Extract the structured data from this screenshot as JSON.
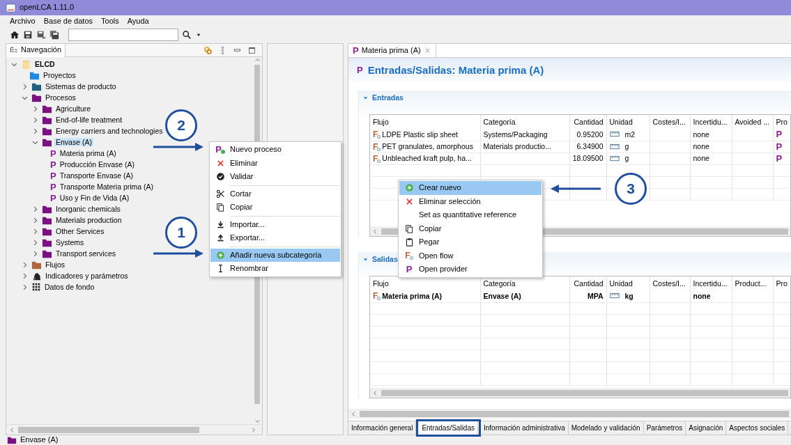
{
  "window": {
    "title": "openLCA 1.11.0"
  },
  "menu": [
    "Archivo",
    "Base de datos",
    "Tools",
    "Ayuda"
  ],
  "navigator": {
    "title": "Navegación",
    "tree": [
      {
        "label": "ELCD",
        "kind": "database",
        "expanded": true,
        "selected": false,
        "children": [
          {
            "label": "Proyectos",
            "kind": "folder",
            "color": "#1e88e5",
            "selected": false
          },
          {
            "label": "Sistemas de producto",
            "kind": "folder",
            "color": "#1f5f80",
            "expanded": false,
            "selected": false
          },
          {
            "label": "Procesos",
            "kind": "folder",
            "color": "#7b1080",
            "expanded": true,
            "selected": false,
            "children": [
              {
                "label": "Agriculture",
                "kind": "folder",
                "color": "#7b1080",
                "expanded": false,
                "selected": false
              },
              {
                "label": "End-of-life treatment",
                "kind": "folder",
                "color": "#7b1080",
                "expanded": false,
                "selected": false
              },
              {
                "label": "Energy carriers and technologies",
                "kind": "folder",
                "color": "#7b1080",
                "expanded": false,
                "selected": false
              },
              {
                "label": "Envase (A)",
                "kind": "folder",
                "color": "#7b1080",
                "expanded": true,
                "selected": true,
                "children": [
                  {
                    "label": "Materia prima (A)",
                    "kind": "process",
                    "glyph": "P",
                    "selected": false
                  },
                  {
                    "label": "Producción Envase (A)",
                    "kind": "process",
                    "glyph": "P",
                    "selected": false
                  },
                  {
                    "label": "Transporte Envase (A)",
                    "kind": "process",
                    "glyph": "P",
                    "selected": false
                  },
                  {
                    "label": "Transporte Materia prima (A)",
                    "kind": "process",
                    "glyph": "P",
                    "selected": false
                  },
                  {
                    "label": "Uso y Fin de Vida (A)",
                    "kind": "process",
                    "glyph": "P",
                    "selected": false
                  }
                ]
              },
              {
                "label": "Inorganic chemicals",
                "kind": "folder",
                "color": "#7b1080",
                "expanded": false,
                "selected": false
              },
              {
                "label": "Materials production",
                "kind": "folder",
                "color": "#7b1080",
                "expanded": false,
                "selected": false
              },
              {
                "label": "Other Services",
                "kind": "folder",
                "color": "#7b1080",
                "expanded": false,
                "selected": false
              },
              {
                "label": "Systems",
                "kind": "folder",
                "color": "#7b1080",
                "expanded": false,
                "selected": false
              },
              {
                "label": "Transport services",
                "kind": "folder",
                "color": "#7b1080",
                "expanded": false,
                "selected": false
              }
            ]
          },
          {
            "label": "Flujos",
            "kind": "folder",
            "color": "#b0663c",
            "expanded": false,
            "selected": false
          },
          {
            "label": "Indicadores y parámetros",
            "kind": "indicators",
            "expanded": false,
            "selected": false
          },
          {
            "label": "Datos de fondo",
            "kind": "background",
            "expanded": false,
            "selected": false
          }
        ]
      }
    ]
  },
  "editor": {
    "tab": {
      "glyph": "P",
      "label": "Materia prima (A)"
    },
    "header": {
      "glyph": "P",
      "title": "Entradas/Salidas: Materia prima (A)"
    },
    "sections": [
      {
        "title": "Entradas",
        "expanded": true,
        "columns": [
          "Flujo",
          "Categoría",
          "Cantidad",
          "Unidad",
          "Costes/I...",
          "Incertidu...",
          "Avoided ...",
          "Pro"
        ],
        "rows": [
          {
            "flow_glyph": "F",
            "flow": "LDPE Plastic slip sheet",
            "category": "Systems/Packaging",
            "amount": "0.95200",
            "unit": "m2",
            "uncertainty": "none",
            "provider": "P",
            "reference": false
          },
          {
            "flow_glyph": "F",
            "flow": "PET granulates, amorphous",
            "category": "Materials productio...",
            "amount": "6.34900",
            "unit": "g",
            "uncertainty": "none",
            "provider": "P",
            "reference": false
          },
          {
            "flow_glyph": "F",
            "flow": "Unbleached kraft pulp, ha...",
            "amount": "18.09500",
            "unit": "g",
            "uncertainty": "none",
            "provider": "P",
            "reference": false
          }
        ]
      },
      {
        "title": "Salidas",
        "expanded": true,
        "columns": [
          "Flujo",
          "Categoría",
          "Cantidad",
          "Unidad",
          "Costes/I...",
          "Incertidu...",
          "Product...",
          "Pro"
        ],
        "rows": [
          {
            "flow_glyph": "F",
            "flow": "Materia prima (A)",
            "category": "Envase (A)",
            "amount": "MPA",
            "unit": "kg",
            "uncertainty": "none",
            "reference": true
          }
        ]
      }
    ],
    "bottom_tabs": [
      {
        "label": "Información general",
        "selected": false
      },
      {
        "label": "Entradas/Salidas",
        "selected": true
      },
      {
        "label": "Información administrativa",
        "selected": false
      },
      {
        "label": "Modelado y validación",
        "selected": false
      },
      {
        "label": "Parámetros",
        "selected": false
      },
      {
        "label": "Asignación",
        "selected": false
      },
      {
        "label": "Aspectos sociales",
        "selected": false
      }
    ]
  },
  "context_menus": [
    {
      "items": [
        {
          "kind": "new-process",
          "glyph": "P",
          "label": "Nuevo proceso",
          "selected": false
        },
        {
          "kind": "delete",
          "label": "Eliminar",
          "selected": false
        },
        {
          "kind": "validate",
          "label": "Validar",
          "selected": false
        },
        {
          "kind": "separator"
        },
        {
          "kind": "cut",
          "label": "Cortar",
          "selected": false
        },
        {
          "kind": "copy",
          "label": "Copiar",
          "selected": false
        },
        {
          "kind": "separator"
        },
        {
          "kind": "import",
          "label": "Importar...",
          "selected": false
        },
        {
          "kind": "export",
          "label": "Exportar...",
          "selected": false
        },
        {
          "kind": "separator"
        },
        {
          "kind": "add",
          "label": "Añadir nueva subcategoría",
          "selected": true
        },
        {
          "kind": "rename",
          "label": "Renombrar",
          "selected": false
        }
      ]
    },
    {
      "items": [
        {
          "kind": "add",
          "label": "Crear nuevo",
          "selected": true
        },
        {
          "kind": "delete",
          "label": "Eliminar selección",
          "selected": false
        },
        {
          "kind": "plain",
          "label": "Set as quantitative reference",
          "selected": false
        },
        {
          "kind": "copy",
          "label": "Copiar",
          "selected": false
        },
        {
          "kind": "paste",
          "label": "Pegar",
          "selected": false
        },
        {
          "kind": "flow",
          "glyph": "F",
          "label": "Open flow",
          "selected": false
        },
        {
          "kind": "process",
          "glyph": "P",
          "label": "Open provider",
          "selected": false
        }
      ]
    }
  ],
  "annotations": [
    {
      "label": "2"
    },
    {
      "label": "1"
    },
    {
      "label": "3"
    }
  ],
  "status_bar": {
    "label": "Envase (A)"
  }
}
